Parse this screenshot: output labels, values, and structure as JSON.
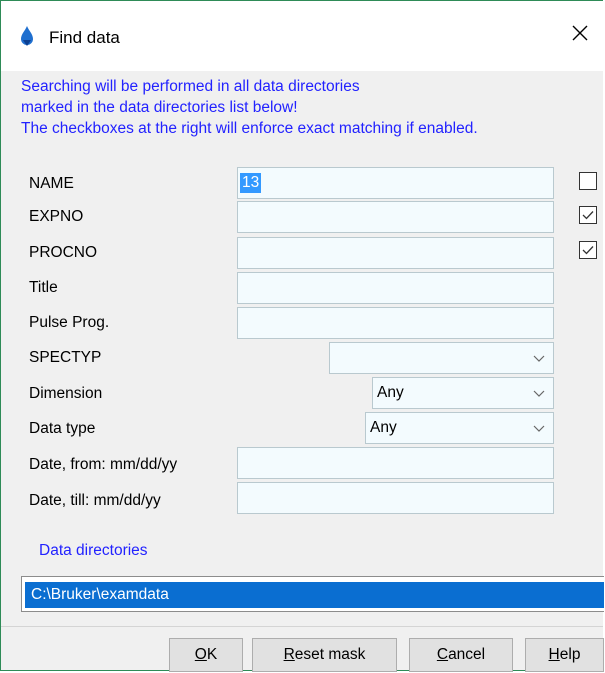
{
  "window": {
    "title": "Find data",
    "icons": {
      "app": "bruker-drop-icon",
      "close": "close-icon"
    }
  },
  "info_lines": [
    "Searching will be performed in all data directories",
    "marked in the data directories list below!",
    "The checkboxes at the right will enforce exact matching if enabled."
  ],
  "fields": {
    "name": {
      "label": "NAME",
      "value": "13",
      "exact": false
    },
    "expno": {
      "label": "EXPNO",
      "value": "",
      "exact": true
    },
    "procno": {
      "label": "PROCNO",
      "value": "",
      "exact": true
    },
    "title": {
      "label": "Title",
      "value": ""
    },
    "pulse_prog": {
      "label": "Pulse Prog.",
      "value": ""
    },
    "spectyp": {
      "label": "SPECTYP",
      "selected": ""
    },
    "dimension": {
      "label": "Dimension",
      "selected": "Any"
    },
    "data_type": {
      "label": "Data type",
      "selected": "Any"
    },
    "date_from": {
      "label": "Date, from: mm/dd/yy",
      "value": ""
    },
    "date_till": {
      "label": "Date, till: mm/dd/yy",
      "value": ""
    }
  },
  "data_directories": {
    "title": "Data directories",
    "items": [
      "C:\\Bruker\\examdata"
    ]
  },
  "buttons": {
    "ok": {
      "mnemonic": "O",
      "rest": "K"
    },
    "reset": {
      "mnemonic": "R",
      "rest": "eset mask"
    },
    "cancel": {
      "mnemonic": "C",
      "rest": "ancel"
    },
    "help": {
      "mnemonic": "H",
      "rest": "elp"
    }
  },
  "colors": {
    "info_text": "#2222ff",
    "selection": "#0a6ed1",
    "input_bg": "#f3fbfe"
  }
}
